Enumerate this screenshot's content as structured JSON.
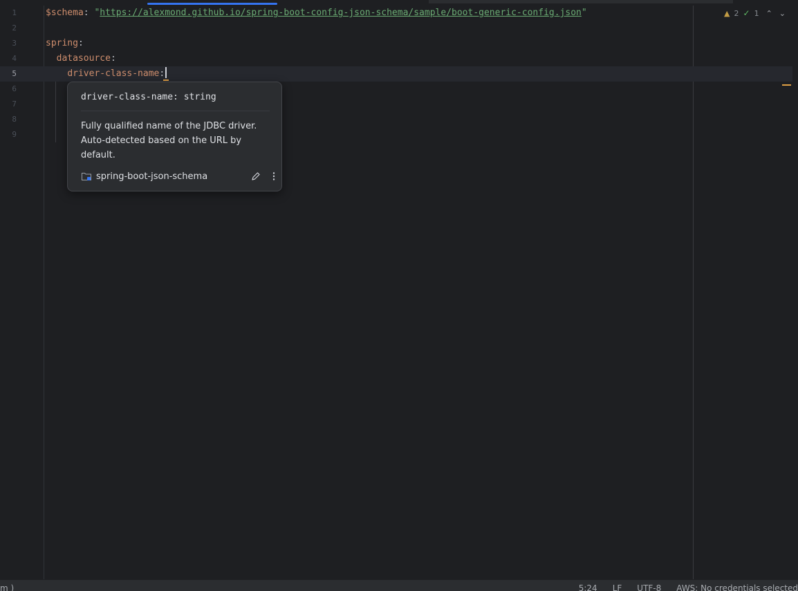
{
  "editor": {
    "lines": [
      {
        "number": "1",
        "key": "$schema",
        "colon": ":",
        "value_quote_open": " \"",
        "url": "https://alexmond.github.io/spring-boot-config-json-schema/sample/boot-generic-config.json",
        "value_quote_close": "\""
      },
      {
        "number": "2"
      },
      {
        "number": "3",
        "key": "spring",
        "colon": ":"
      },
      {
        "number": "4",
        "indent": "  ",
        "key": "datasource",
        "colon": ":"
      },
      {
        "number": "5",
        "indent": "    ",
        "key": "driver-class-name",
        "colon": ":"
      },
      {
        "number": "6"
      },
      {
        "number": "7"
      },
      {
        "number": "8"
      },
      {
        "number": "9"
      }
    ],
    "current_line": 5
  },
  "inspections": {
    "warnings": "2",
    "ok": "1",
    "warning_color": "#c29c45",
    "ok_color": "#5fb865"
  },
  "popup": {
    "signature": "driver-class-name: string",
    "description": "Fully qualified name of the JDBC driver. Auto-detected based on the URL by default.",
    "source": "spring-boot-json-schema",
    "icons": {
      "source": "folder-icon",
      "edit": "pencil-icon",
      "more": "more-vertical-icon"
    }
  },
  "statusbar": {
    "left_text": "m )",
    "position": "5:24",
    "line_separator": "LF",
    "encoding": "UTF-8",
    "aws": "AWS: No credentials selected"
  },
  "colors": {
    "background": "#1e1f22",
    "key": "#cf8e6d",
    "string": "#6aab73",
    "accent": "#3574f0"
  }
}
